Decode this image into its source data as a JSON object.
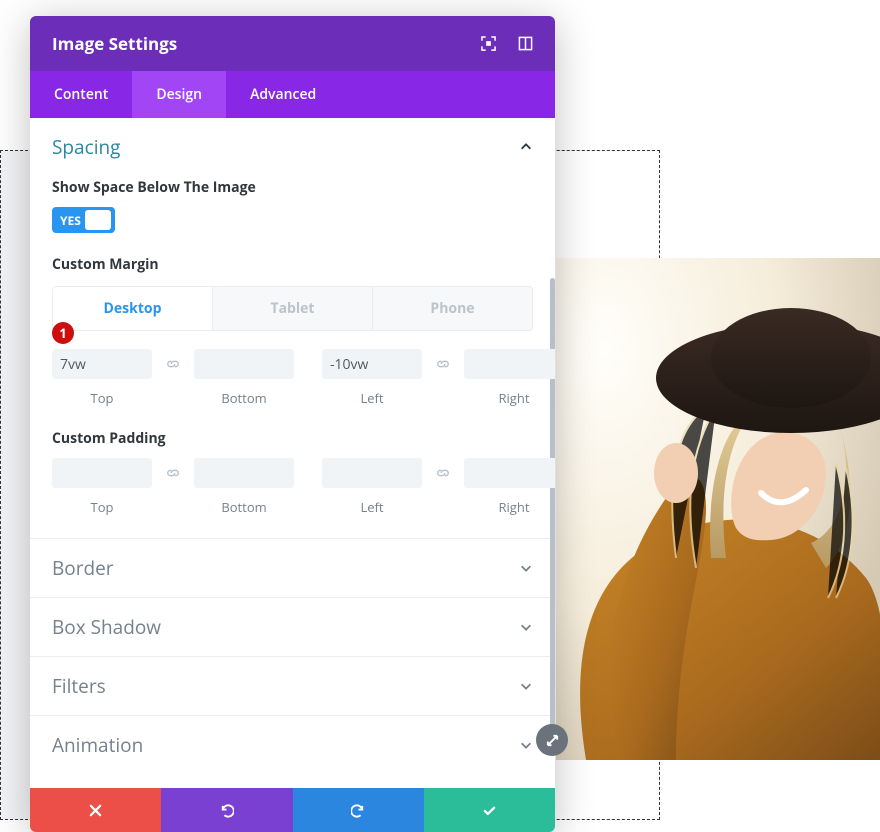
{
  "header": {
    "title": "Image Settings"
  },
  "tabs": {
    "content": "Content",
    "design": "Design",
    "advanced": "Advanced",
    "active": "design"
  },
  "spacing": {
    "title": "Spacing",
    "show_space_label": "Show Space Below The Image",
    "toggle_text": "YES",
    "custom_margin_label": "Custom Margin",
    "responsive": {
      "desktop": "Desktop",
      "tablet": "Tablet",
      "phone": "Phone"
    },
    "margin": {
      "top": "7vw",
      "bottom": "",
      "left": "-10vw",
      "right": "",
      "labels": {
        "top": "Top",
        "bottom": "Bottom",
        "left": "Left",
        "right": "Right"
      }
    },
    "custom_padding_label": "Custom Padding",
    "padding": {
      "top": "",
      "bottom": "",
      "left": "",
      "right": "",
      "labels": {
        "top": "Top",
        "bottom": "Bottom",
        "left": "Left",
        "right": "Right"
      }
    }
  },
  "sections": {
    "border": "Border",
    "box_shadow": "Box Shadow",
    "filters": "Filters",
    "animation": "Animation"
  },
  "marker": "1"
}
